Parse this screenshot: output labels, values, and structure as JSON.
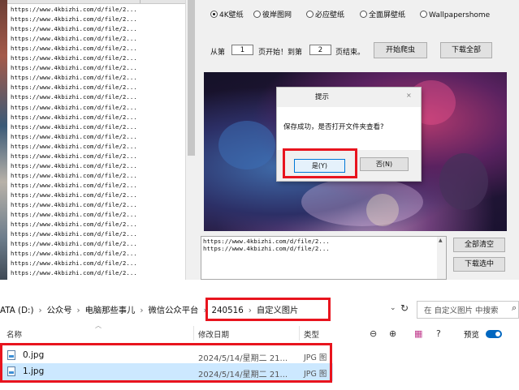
{
  "app": {
    "url_list": [
      "https://www.4kbizhi.com/d/file/2...",
      "https://www.4kbizhi.com/d/file/2...",
      "https://www.4kbizhi.com/d/file/2...",
      "https://www.4kbizhi.com/d/file/2...",
      "https://www.4kbizhi.com/d/file/2...",
      "https://www.4kbizhi.com/d/file/2...",
      "https://www.4kbizhi.com/d/file/2...",
      "https://www.4kbizhi.com/d/file/2...",
      "https://www.4kbizhi.com/d/file/2...",
      "https://www.4kbizhi.com/d/file/2...",
      "https://www.4kbizhi.com/d/file/2...",
      "https://www.4kbizhi.com/d/file/2...",
      "https://www.4kbizhi.com/d/file/2...",
      "https://www.4kbizhi.com/d/file/2...",
      "https://www.4kbizhi.com/d/file/2...",
      "https://www.4kbizhi.com/d/file/2...",
      "https://www.4kbizhi.com/d/file/2...",
      "https://www.4kbizhi.com/d/file/2...",
      "https://www.4kbizhi.com/d/file/2...",
      "https://www.4kbizhi.com/d/file/2...",
      "https://www.4kbizhi.com/d/file/2...",
      "https://www.4kbizhi.com/d/file/2...",
      "https://www.4kbizhi.com/d/file/2...",
      "https://www.4kbizhi.com/d/file/2...",
      "https://www.4kbizhi.com/d/file/2...",
      "https://www.4kbizhi.com/d/file/2...",
      "https://www.4kbizhi.com/d/file/2...",
      "https://www.4kbizhi.com/d/file/2..."
    ],
    "sources": [
      {
        "label": "4K壁纸",
        "selected": true
      },
      {
        "label": "彼岸图网",
        "selected": false
      },
      {
        "label": "必应壁纸",
        "selected": false
      },
      {
        "label": "全面屏壁纸",
        "selected": false
      },
      {
        "label": "Wallpapershome",
        "selected": false
      }
    ],
    "range": {
      "from_label": "从第",
      "start_page": "1",
      "mid_label": "页开始！到第",
      "end_page": "2",
      "end_label": "页结束。"
    },
    "buttons": {
      "start_crawl": "开始爬虫",
      "download_all": "下载全部",
      "clear_all": "全部清空",
      "download_selected": "下载选中"
    },
    "log": [
      "https://www.4kbizhi.com/d/file/2...",
      "https://www.4kbizhi.com/d/file/2..."
    ],
    "dialog": {
      "title": "提示",
      "close": "×",
      "message": "保存成功，是否打开文件夹查看?",
      "yes": "是(Y)",
      "no": "否(N)"
    }
  },
  "explorer": {
    "breadcrumbs": [
      "ATA (D:)",
      "公众号",
      "电脑那些事儿",
      "微信公众平台",
      "240516",
      "自定义图片"
    ],
    "search_placeholder": "在 自定义图片 中搜索",
    "columns": {
      "name": "名称",
      "date": "修改日期",
      "type": "类型"
    },
    "preview_label": "预览",
    "files": [
      {
        "name": "0.jpg",
        "date": "2024/5/14/星期二 21...",
        "type": "JPG 图",
        "selected": false
      },
      {
        "name": "1.jpg",
        "date": "2024/5/14/星期二 21...",
        "type": "JPG 图",
        "selected": true
      }
    ],
    "colors": {
      "highlight": "#e8141e",
      "selection": "#cce8ff",
      "accent": "#0067c0"
    }
  }
}
